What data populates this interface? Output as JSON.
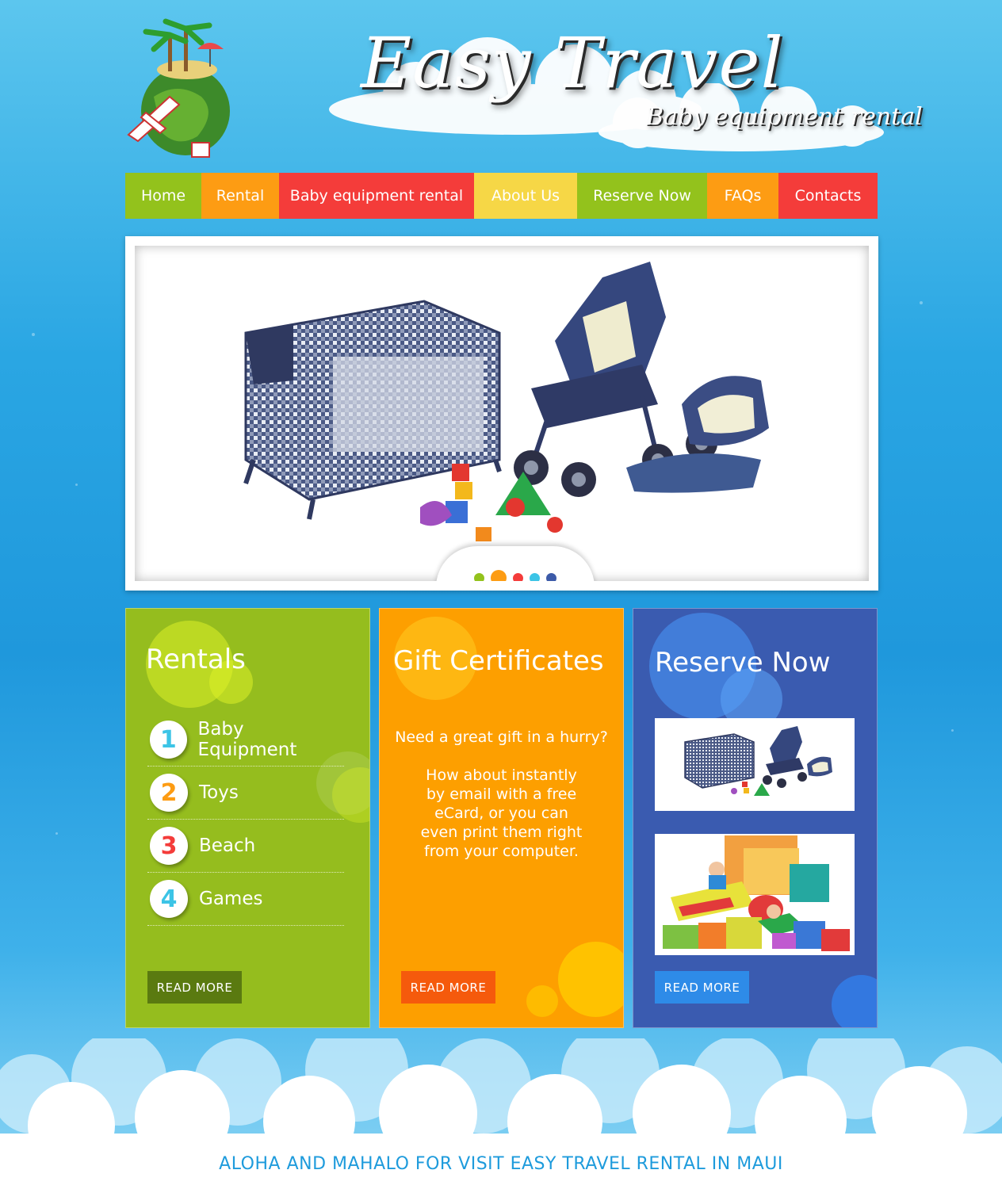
{
  "header": {
    "title": "Easy Travel",
    "subtitle": "Baby equipment rental"
  },
  "nav": {
    "items": [
      {
        "label": "Home",
        "color": "#93c21c"
      },
      {
        "label": "Rental",
        "color": "#fd9c13"
      },
      {
        "label": "Baby equipment rental",
        "color": "#f43c3a"
      },
      {
        "label": "About Us",
        "color": "#f6d746"
      },
      {
        "label": "Reserve Now",
        "color": "#93c21c"
      },
      {
        "label": "FAQs",
        "color": "#fd9c13"
      },
      {
        "label": "Contacts",
        "color": "#f43c3a"
      }
    ]
  },
  "slider": {
    "dots": [
      "#93c21c",
      "#fd9c13",
      "#f43c3a",
      "#3cc4e6",
      "#3c5aa8"
    ],
    "active_dot": 1
  },
  "rentals": {
    "title": "Rentals",
    "items": [
      {
        "number": "1",
        "label": "Baby Equipment",
        "color": "#3cc4e6"
      },
      {
        "number": "2",
        "label": "Toys",
        "color": "#fd9c13"
      },
      {
        "number": "3",
        "label": "Beach",
        "color": "#f43c3a"
      },
      {
        "number": "4",
        "label": "Games",
        "color": "#3cc4e6"
      }
    ],
    "button": "READ MORE"
  },
  "gift": {
    "title": "Gift Certificates",
    "line1": "Need a great gift in a hurry?",
    "line2": "How about instantly by email with a free eCard, or you can even print them right from your computer.",
    "button": "READ MORE"
  },
  "reserve": {
    "title": "Reserve Now",
    "button": "READ MORE"
  },
  "footer": {
    "text": "ALOHA AND MAHALO FOR VISIT EASY TRAVEL RENTAL IN MAUI"
  }
}
